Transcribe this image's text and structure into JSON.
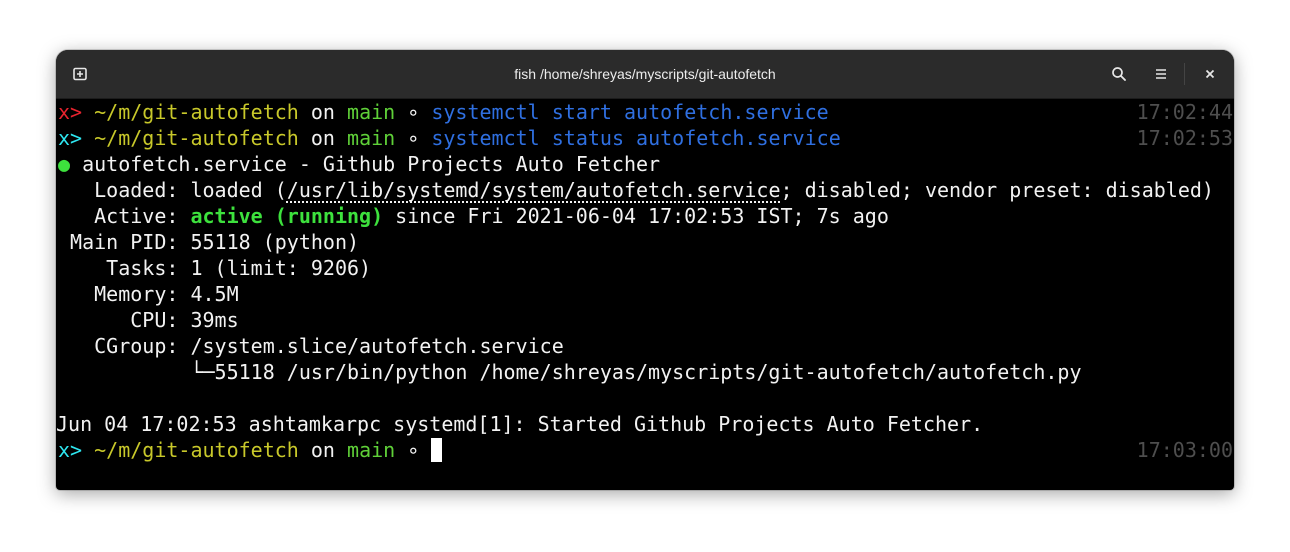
{
  "window": {
    "title": "fish /home/shreyas/myscripts/git-autofetch"
  },
  "prompt": {
    "path": "~/m/git-autofetch",
    "on": "on",
    "branch": "main",
    "ring": "∘"
  },
  "lines": {
    "cmd1": {
      "arrow": "x>",
      "program": "systemctl",
      "args": "start autofetch.service",
      "time": "17:02:44"
    },
    "cmd2": {
      "arrow": "x>",
      "program": "systemctl",
      "args": "status autofetch.service",
      "time": "17:02:53"
    },
    "status_header": {
      "dot": "●",
      "text": "autofetch.service - Github Projects Auto Fetcher"
    },
    "loaded": {
      "label": "Loaded:",
      "prefix": "loaded (",
      "path": "/usr/lib/systemd/system/autofetch.service",
      "suffix": "; disabled; vendor preset: disabled)"
    },
    "active": {
      "label": "Active:",
      "state": "active (running)",
      "rest": "since Fri 2021-06-04 17:02:53 IST; 7s ago"
    },
    "main_pid": {
      "label": "Main PID:",
      "value": "55118 (python)"
    },
    "tasks": {
      "label": "Tasks:",
      "value": "1 (limit: 9206)"
    },
    "memory": {
      "label": "Memory:",
      "value": "4.5M"
    },
    "cpu": {
      "label": "CPU:",
      "value": "39ms"
    },
    "cgroup": {
      "label": "CGroup:",
      "value": "/system.slice/autofetch.service"
    },
    "cgroup_child": {
      "tree": "└─",
      "value": "55118 /usr/bin/python /home/shreyas/myscripts/git-autofetch/autofetch.py"
    },
    "log": {
      "text": "Jun 04 17:02:53 ashtamkarpc systemd[1]: Started Github Projects Auto Fetcher."
    },
    "prompt3": {
      "arrow": "x>",
      "time": "17:03:00"
    }
  },
  "colors": {
    "error_arrow": "#e8232e",
    "ok_arrow": "#2ee6f0",
    "path": "#c8c82a",
    "branch": "#5fd038",
    "command": "#2f6fe0",
    "active": "#3de13d",
    "timestamp": "#4e4e4e"
  },
  "icons": {
    "new_tab": "new-tab-icon",
    "search": "search-icon",
    "menu": "hamburger-menu-icon",
    "close": "close-icon"
  }
}
